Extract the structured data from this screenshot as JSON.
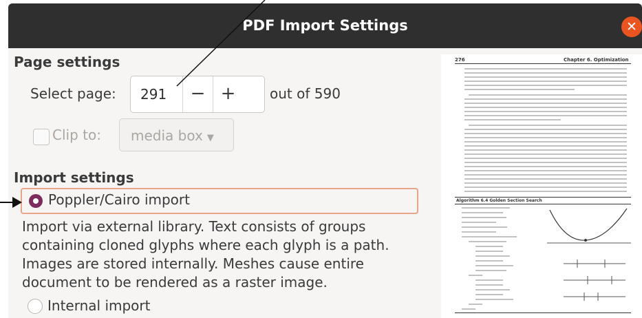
{
  "window": {
    "title": "PDF Import Settings",
    "close_icon": "close-icon"
  },
  "page_settings": {
    "heading": "Page settings",
    "select_page_label": "Select page:",
    "page_value": "291",
    "decrement": "−",
    "increment": "+",
    "out_of": "out of 590",
    "clip_label": "Clip to:",
    "clip_option": "media box"
  },
  "import_settings": {
    "heading": "Import settings",
    "option1": "Poppler/Cairo import",
    "option1_desc": "Import via external library. Text consists of groups containing cloned glyphs where each glyph is a path. Images are stored internally. Meshes cause entire document to be rendered as a raster image.",
    "option2": "Internal import"
  },
  "preview": {
    "page_number": "276",
    "chapter_header": "Chapter 6. Optimization",
    "algorithm_caption": "Algorithm 6.4 Golden Section Search"
  }
}
